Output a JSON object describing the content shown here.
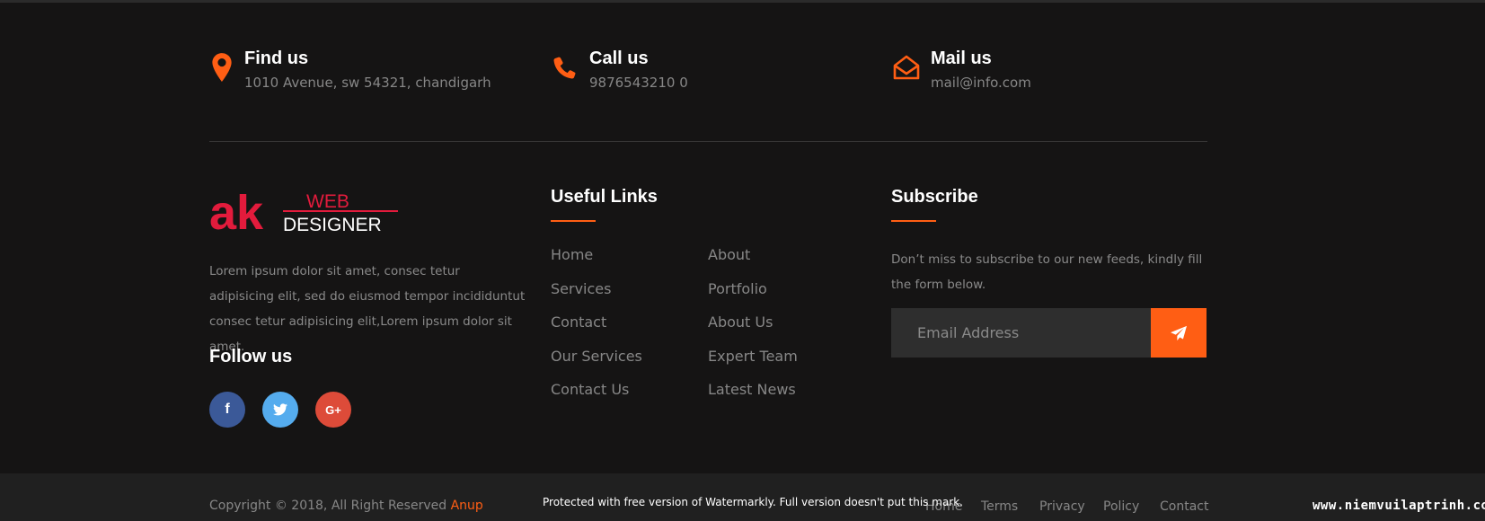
{
  "colors": {
    "accent": "#ff5e14",
    "background": "#151414",
    "bottom_bar": "#202020",
    "facebook": "#3b5998",
    "twitter": "#55acee",
    "google_plus": "#dd4b39"
  },
  "contact": {
    "find": {
      "title": "Find us",
      "text": "1010 Avenue, sw 54321, chandigarh",
      "icon": "map-marker-icon"
    },
    "call": {
      "title": "Call us",
      "text": "9876543210 0",
      "icon": "phone-icon"
    },
    "mail": {
      "title": "Mail us",
      "text": "mail@info.com",
      "icon": "envelope-open-icon"
    }
  },
  "logo": {
    "mark": "ak",
    "line1": "WEB",
    "line2": "DESIGNER"
  },
  "about": {
    "text": "Lorem ipsum dolor sit amet, consec tetur adipisicing elit, sed do eiusmod tempor incididuntut consec tetur adipisicing elit,Lorem ipsum dolor sit amet.",
    "follow_title": "Follow us",
    "social": [
      {
        "name": "facebook",
        "glyph": "f"
      },
      {
        "name": "twitter",
        "glyph": "twitter-bird-icon"
      },
      {
        "name": "google-plus",
        "glyph": "G+"
      }
    ]
  },
  "links": {
    "title": "Useful Links",
    "col1": [
      "Home",
      "Services",
      "Contact",
      "Our Services",
      "Contact Us"
    ],
    "col2": [
      "About",
      "Portfolio",
      "About Us",
      "Expert Team",
      "Latest News"
    ]
  },
  "subscribe": {
    "title": "Subscribe",
    "text": "Don’t miss to subscribe to our new feeds, kindly fill the form below.",
    "placeholder": "Email Address",
    "button_icon": "paper-plane-icon"
  },
  "footer": {
    "copyright": "Copyright © 2018, All Right Reserved ",
    "author": "Anup",
    "nav": [
      "Home",
      "Terms",
      "Privacy",
      "Policy",
      "Contact"
    ],
    "watermark": "Protected with free version of Watermarkly. Full version doesn't put this mark.",
    "site": "www.niemvuilaptrinh.com"
  }
}
